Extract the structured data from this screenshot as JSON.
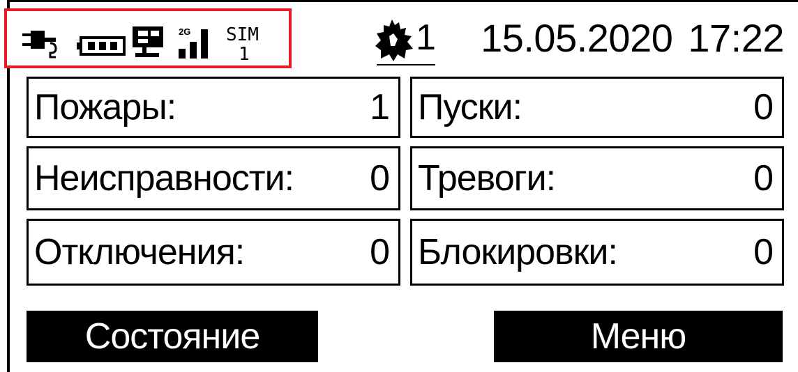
{
  "status_bar": {
    "icons": [
      {
        "name": "power-plug-icon"
      },
      {
        "name": "battery-icon"
      },
      {
        "name": "network-pc-icon"
      },
      {
        "name": "signal-strength-icon",
        "network_label": "2G",
        "level": 3,
        "max_level": 4
      },
      {
        "name": "sim-icon",
        "label": "SIM",
        "number": "1"
      }
    ],
    "fire_icon": "fire-hand-icon",
    "fire_count": "1",
    "date": "15.05.2020",
    "time": "17:22"
  },
  "counters": {
    "fires": {
      "label": "Пожары:",
      "value": "1"
    },
    "launches": {
      "label": "Пуски:",
      "value": "0"
    },
    "faults": {
      "label": "Неисправности:",
      "value": "0"
    },
    "alarms": {
      "label": "Тревоги:",
      "value": "0"
    },
    "disconnects": {
      "label": "Отключения:",
      "value": "0"
    },
    "blocks": {
      "label": "Блокировки:",
      "value": "0"
    }
  },
  "buttons": {
    "status": "Состояние",
    "menu": "Меню"
  },
  "colors": {
    "highlight_box": "#e81c24",
    "foreground": "#000000",
    "background": "#ffffff"
  }
}
